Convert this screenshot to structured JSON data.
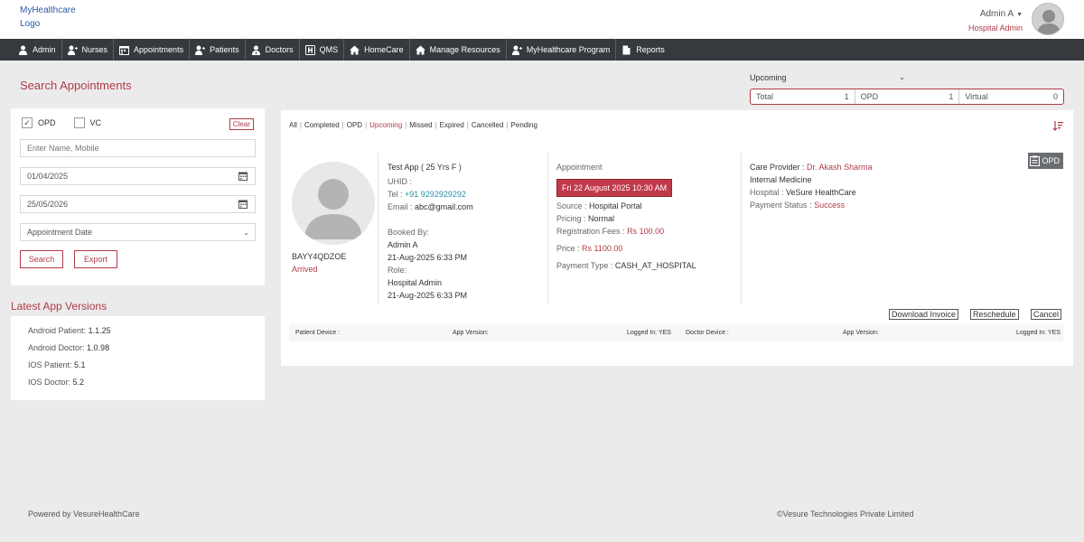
{
  "header": {
    "logo_line1": "MyHealthcare",
    "logo_line2": "Logo",
    "user_name": "Admin A",
    "user_role": "Hospital Admin"
  },
  "nav": {
    "items": [
      {
        "label": "Admin",
        "icon": "user-icon"
      },
      {
        "label": "Nurses",
        "icon": "user-plus-icon"
      },
      {
        "label": "Appointments",
        "icon": "calendar-icon"
      },
      {
        "label": "Patients",
        "icon": "user-plus-icon"
      },
      {
        "label": "Doctors",
        "icon": "user-md-icon"
      },
      {
        "label": "QMS",
        "icon": "hospital-icon"
      },
      {
        "label": "HomeCare",
        "icon": "home-icon"
      },
      {
        "label": "Manage Resources",
        "icon": "home-icon"
      },
      {
        "label": "MyHealthcare Program",
        "icon": "user-plus-icon"
      },
      {
        "label": "Reports",
        "icon": "file-icon"
      }
    ]
  },
  "search": {
    "title": "Search Appointments",
    "opd_label": "OPD",
    "opd_checked": true,
    "vc_label": "VC",
    "vc_checked": false,
    "clear_label": "Clear",
    "name_placeholder": "Enter Name, Mobile",
    "date_from": "01/04/2025",
    "date_to": "25/05/2026",
    "date_type": "Appointment Date",
    "search_label": "Search",
    "export_label": "Export"
  },
  "versions": {
    "title": "Latest App Versions",
    "items": [
      {
        "label": "Android Patient:",
        "value": "1.1.25"
      },
      {
        "label": "Android Doctor:",
        "value": "1.0.98"
      },
      {
        "label": "IOS Patient:",
        "value": "5.1"
      },
      {
        "label": "IOS Doctor:",
        "value": "5.2"
      }
    ]
  },
  "summary": {
    "filter_value": "Upcoming",
    "total_label": "Total",
    "total_value": "1",
    "opd_label": "OPD",
    "opd_value": "1",
    "virtual_label": "Virtual",
    "virtual_value": "0"
  },
  "filters": {
    "items": [
      "All",
      "Completed",
      "OPD",
      "Upcoming",
      "Missed",
      "Expired",
      "Cancelled",
      "Pending"
    ],
    "active": "Upcoming"
  },
  "appointment": {
    "patient_id": "BAYY4QDZOE",
    "status": "Arrived",
    "name_age": "Test App ( 25 Yrs F )",
    "uhid_label": "UHID :",
    "tel_label": "Tel :",
    "tel_value": "+91 9292929292",
    "email_label": "Email :",
    "email_value": "abc@gmail.com",
    "booked_by_label": "Booked By:",
    "booked_by_value": "Admin A",
    "booked_time": "21-Aug-2025 6:33 PM",
    "role_label": "Role:",
    "role_value": "Hospital Admin",
    "role_time": "21-Aug-2025 6:33 PM",
    "appointment_label": "Appointment",
    "appointment_datetime": "Fri 22 August 2025  10:30 AM",
    "source_label": "Source :",
    "source_value": "Hospital Portal",
    "pricing_label": "Pricing :",
    "pricing_value": "Normal",
    "reg_fees_label": "Registration Fees :",
    "reg_fees_value": "Rs 100.00",
    "price_label": "Price :",
    "price_value": "Rs 1100.00",
    "payment_type_label": "Payment Type :",
    "payment_type_value": "CASH_AT_HOSPITAL",
    "care_provider_label": "Care Provider :",
    "care_provider_value": "Dr. Akash Sharma",
    "department": "Internal Medicine",
    "hospital_label": "Hospital :",
    "hospital_value": "VeSure HealthCare",
    "payment_status_label": "Payment Status :",
    "payment_status_value": "Success",
    "tag": "OPD",
    "download_invoice_label": "Download Invoice",
    "reschedule_label": "Reschedule",
    "cancel_label": "Cancel",
    "patient_device_label": "Patient Device :",
    "patient_app_version_label": "App Version:",
    "patient_logged_in": "Logged In: YES",
    "doctor_device_label": "Doctor Device :",
    "doctor_app_version_label": "App Version:",
    "doctor_logged_in": "Logged In: YES"
  },
  "footer": {
    "left": "Powered by VesureHealthCare",
    "right": "©Vesure Technologies Private Limited"
  },
  "colors": {
    "accent": "#b03a48",
    "nav_bg": "#36393d",
    "page_bg": "#ebebeb"
  }
}
